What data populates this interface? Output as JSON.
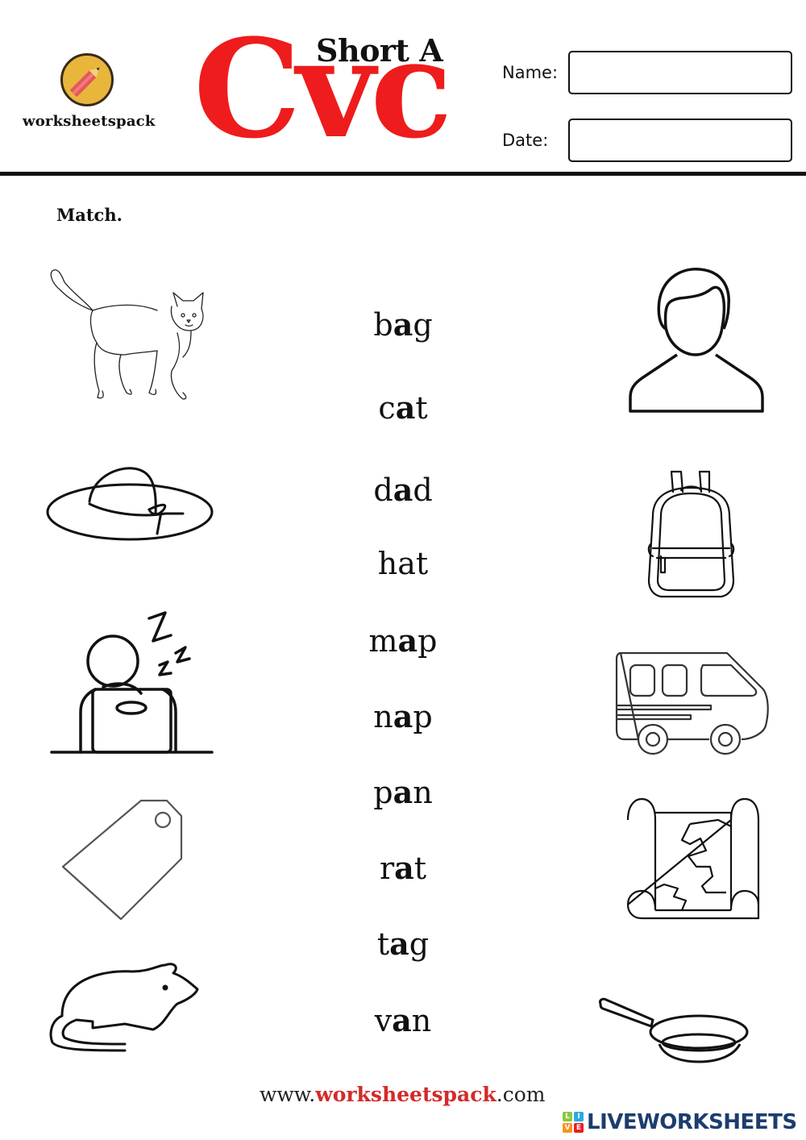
{
  "header": {
    "brand": "worksheetspack",
    "subtitle": "Short A",
    "title": "Cvc",
    "name_label": "Name:",
    "name_value": "",
    "date_label": "Date:",
    "date_value": ""
  },
  "instruction": "Match.",
  "words": [
    {
      "pre": "b",
      "vowel": "a",
      "post": "g"
    },
    {
      "pre": "c",
      "vowel": "a",
      "post": "t"
    },
    {
      "pre": "d",
      "vowel": "a",
      "post": "d"
    },
    {
      "pre": "h",
      "vowel": "a",
      "post": "t"
    },
    {
      "pre": "m",
      "vowel": "a",
      "post": "p"
    },
    {
      "pre": "n",
      "vowel": "a",
      "post": "p"
    },
    {
      "pre": "p",
      "vowel": "a",
      "post": "n"
    },
    {
      "pre": "r",
      "vowel": "a",
      "post": "t"
    },
    {
      "pre": "t",
      "vowel": "a",
      "post": "g"
    },
    {
      "pre": "v",
      "vowel": "a",
      "post": "n"
    }
  ],
  "left_pictures": [
    "cat-icon",
    "hat-icon",
    "nap-icon",
    "tag-icon",
    "rat-icon"
  ],
  "right_pictures": [
    "dad-icon",
    "bag-icon",
    "van-icon",
    "map-icon",
    "pan-icon"
  ],
  "footer": {
    "url_prefix": "www.",
    "url_brand": "worksheetspack",
    "url_suffix": ".com",
    "liveworksheets": "LIVEWORKSHEETS",
    "live_letters": [
      "L",
      "I",
      "V",
      "E"
    ]
  },
  "colors": {
    "accent_red": "#ee1c1c",
    "footer_red": "#d42a2a",
    "logo_yellow": "#e9b63c",
    "lw_blue": "#1c3d6e",
    "lw_tiles": [
      "#8cc63f",
      "#29abe2",
      "#f7931e",
      "#ed1c24"
    ]
  }
}
